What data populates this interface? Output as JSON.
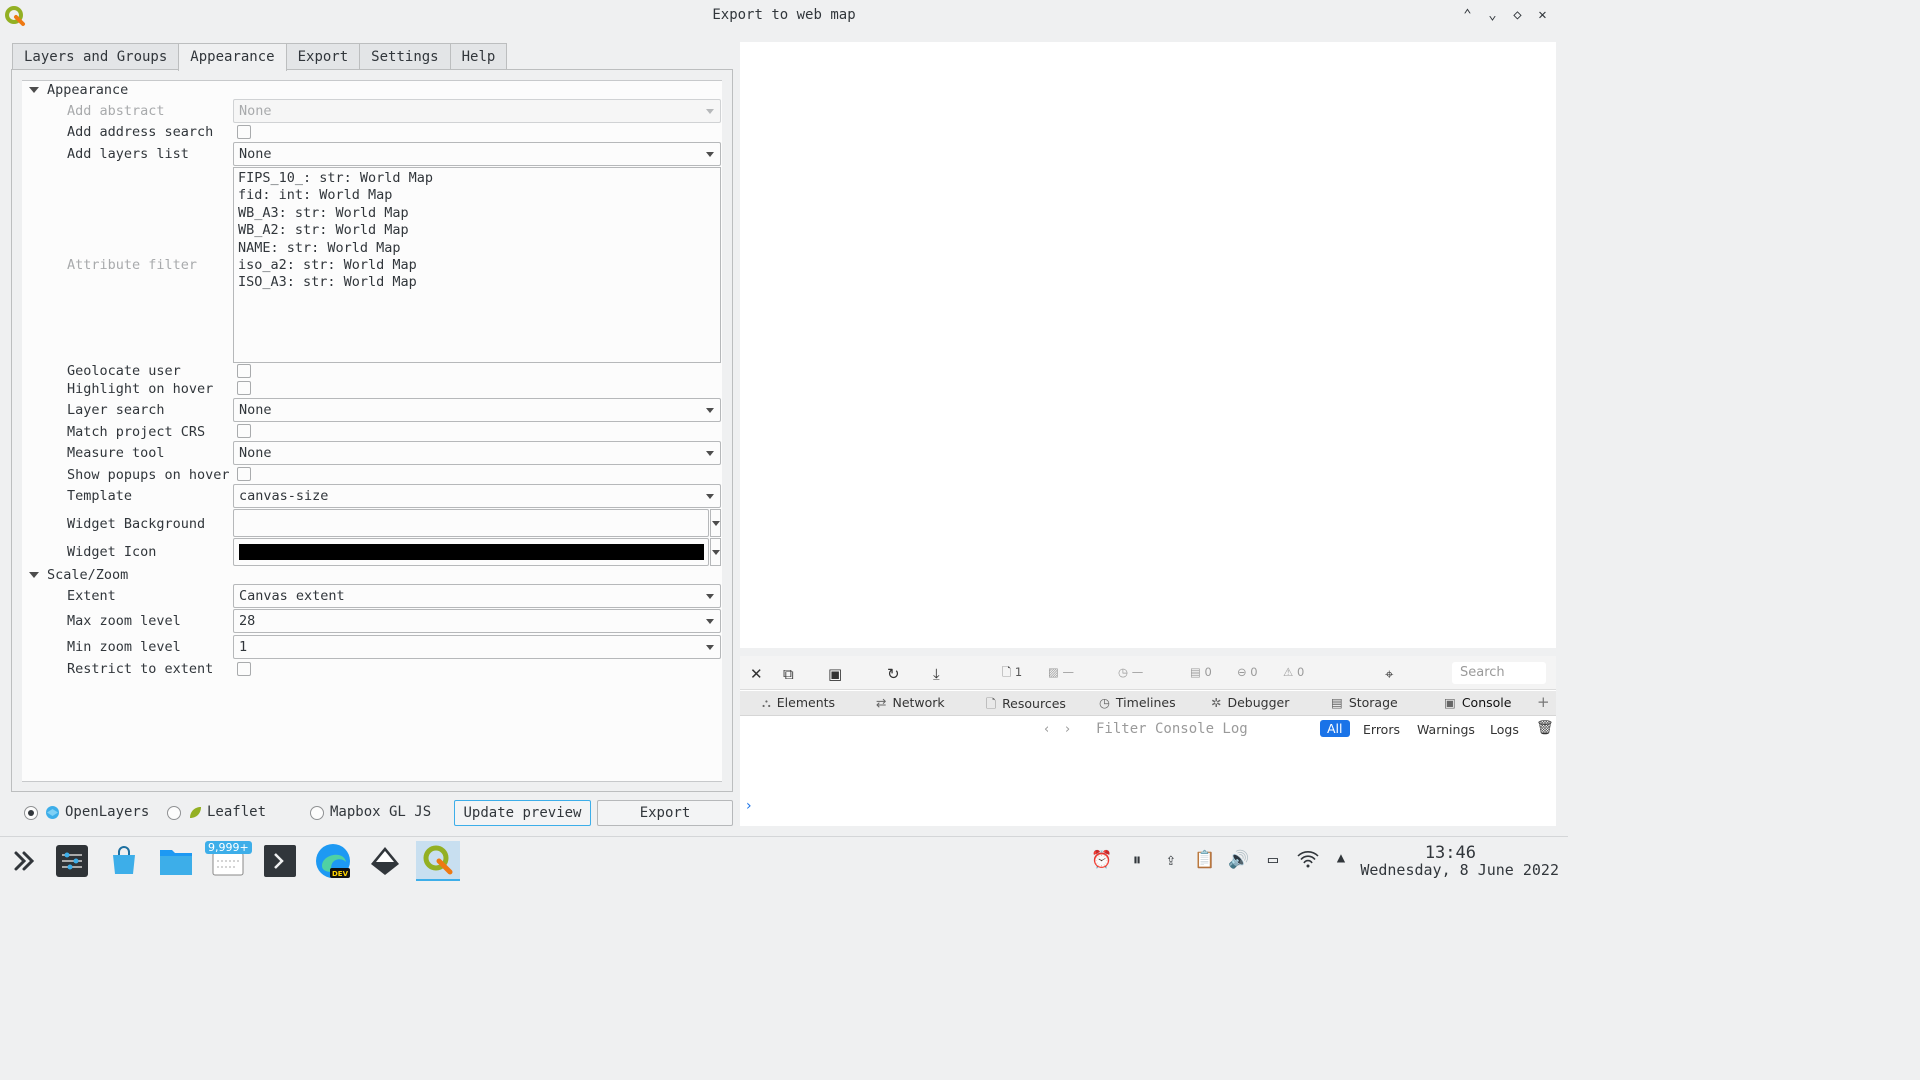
{
  "window": {
    "title": "Export to web map",
    "controls": [
      "⌃",
      "⌄",
      "◇",
      "✕"
    ]
  },
  "tabs": [
    "Layers and Groups",
    "Appearance",
    "Export",
    "Settings",
    "Help"
  ],
  "appearance": {
    "group_appearance": "Appearance",
    "add_abstract": {
      "label": "Add abstract",
      "value": "None"
    },
    "add_address_search": {
      "label": "Add address search"
    },
    "add_layers_list": {
      "label": "Add layers list",
      "value": "None"
    },
    "attribute_filter": {
      "label": "Attribute filter",
      "items": [
        "FIPS_10_: str: World Map",
        "fid: int: World Map",
        "WB_A3: str: World Map",
        "WB_A2: str: World Map",
        "NAME: str: World Map",
        "iso_a2: str: World Map",
        "ISO_A3: str: World Map"
      ]
    },
    "geolocate_user": {
      "label": "Geolocate user"
    },
    "highlight_on_hover": {
      "label": "Highlight on hover"
    },
    "layer_search": {
      "label": "Layer search",
      "value": "None"
    },
    "match_project_crs": {
      "label": "Match project CRS"
    },
    "measure_tool": {
      "label": "Measure tool",
      "value": "None"
    },
    "show_popups_on_hover": {
      "label": "Show popups on hover"
    },
    "template": {
      "label": "Template",
      "value": "canvas-size"
    },
    "widget_background": {
      "label": "Widget Background",
      "color": "#fcfcfc"
    },
    "widget_icon": {
      "label": "Widget Icon",
      "color": "#000000"
    },
    "group_scale_zoom": "Scale/Zoom",
    "extent": {
      "label": "Extent",
      "value": "Canvas extent"
    },
    "max_zoom": {
      "label": "Max zoom level",
      "value": "28"
    },
    "min_zoom": {
      "label": "Min zoom level",
      "value": "1"
    },
    "restrict_to_extent": {
      "label": "Restrict to extent"
    }
  },
  "bottom": {
    "openlayers": "OpenLayers",
    "leaflet": "Leaflet",
    "mapbox": "Mapbox GL JS",
    "selected": "OpenLayers",
    "update_preview": "Update preview",
    "export": "Export"
  },
  "inspector": {
    "toolbar": {
      "resources_count": "1",
      "images_count": "—",
      "time": "—",
      "storage_count": "0",
      "errors_count": "0",
      "warnings_count": "0",
      "search_placeholder": "Search"
    },
    "tabs": [
      "Elements",
      "Network",
      "Resources",
      "Timelines",
      "Debugger",
      "Storage",
      "Console"
    ],
    "active_tab": "Console",
    "filter_placeholder": "Filter Console Log",
    "levels": [
      "All",
      "Errors",
      "Warnings",
      "Logs"
    ],
    "active_level": "All"
  },
  "taskbar": {
    "notification_badge": "9,999+",
    "time": "13:46",
    "date": "Wednesday, 8 June 2022"
  },
  "colors": {
    "accent": "#3daee9",
    "qgis_green": "#93b023",
    "inspector_blue": "#1a73e8"
  }
}
